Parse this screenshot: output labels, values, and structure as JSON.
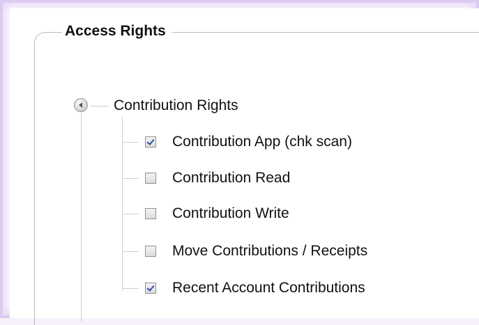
{
  "fieldset": {
    "legend": "Access Rights"
  },
  "tree": {
    "root": {
      "label": "Contribution Rights",
      "icon": "collapse-arrow-icon",
      "expanded": true
    },
    "children": [
      {
        "label": "Contribution App (chk scan)",
        "checked": true
      },
      {
        "label": "Contribution Read",
        "checked": false
      },
      {
        "label": "Contribution Write",
        "checked": false
      },
      {
        "label": "Move Contributions / Receipts",
        "checked": false
      },
      {
        "label": "Recent Account Contributions",
        "checked": true
      }
    ]
  },
  "colors": {
    "frame_border": "#dccbf0",
    "check_mark": "#2c4ea6",
    "tree_lines": "#cfcfcf"
  }
}
